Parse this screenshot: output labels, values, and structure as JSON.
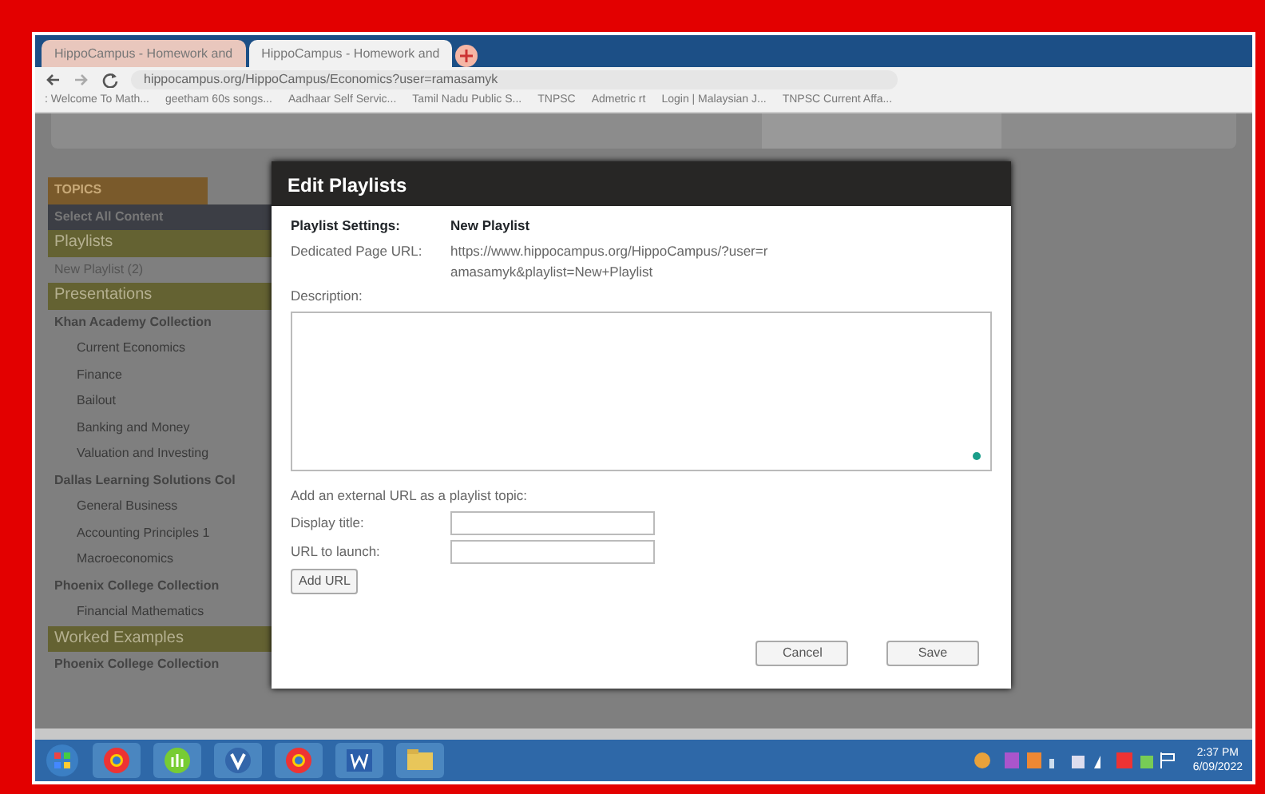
{
  "browser": {
    "tabs": [
      {
        "title": "HippoCampus - Homework and",
        "selected": false
      },
      {
        "title": "HippoCampus - Homework and",
        "selected": true
      }
    ],
    "address": "hippocampus.org/HippoCampus/Economics?user=ramasamyk",
    "bookmarks": [
      ": Welcome To Math...",
      "geetham 60s songs...",
      "Aadhaar Self Servic...",
      "Tamil Nadu Public S...",
      "TNPSC",
      "Admetric rt",
      "Login | Malaysian J...",
      "TNPSC Current Affa..."
    ]
  },
  "sidebar": {
    "items": [
      {
        "kind": "topics",
        "label": "TOPICS"
      },
      {
        "kind": "select_all",
        "label": "Select All Content"
      },
      {
        "kind": "header",
        "label": "Playlists"
      },
      {
        "kind": "playlist",
        "label": "New Playlist (2)"
      },
      {
        "kind": "header",
        "label": "Presentations"
      },
      {
        "kind": "group",
        "label": "Khan Academy Collection"
      },
      {
        "kind": "item",
        "label": "Current Economics"
      },
      {
        "kind": "item",
        "label": "Finance"
      },
      {
        "kind": "item",
        "label": "Bailout"
      },
      {
        "kind": "item",
        "label": "Banking and Money"
      },
      {
        "kind": "item",
        "label": "Valuation and Investing"
      },
      {
        "kind": "group",
        "label": "Dallas Learning Solutions Col"
      },
      {
        "kind": "item",
        "label": "General Business"
      },
      {
        "kind": "item",
        "label": "Accounting Principles 1"
      },
      {
        "kind": "item",
        "label": "Macroeconomics"
      },
      {
        "kind": "group",
        "label": "Phoenix College Collection"
      },
      {
        "kind": "item",
        "label": "Financial Mathematics"
      },
      {
        "kind": "header",
        "label": "Worked Examples"
      },
      {
        "kind": "group",
        "label": "Phoenix College Collection"
      }
    ]
  },
  "dialog": {
    "title": "Edit Playlists",
    "settings_label": "Playlist Settings:",
    "settings_value": "New Playlist",
    "url_label": "Dedicated Page URL:",
    "url_value": "https://www.hippocampus.org/HippoCampus/?user=ramasamyk&playlist=New+Playlist",
    "description_label": "Description:",
    "external_heading": "Add an external URL as a playlist topic:",
    "fields": [
      {
        "label": "Display title:"
      },
      {
        "label": "URL to launch:"
      }
    ],
    "add_button": "Add URL",
    "buttons": [
      "Cancel",
      "Save"
    ]
  },
  "taskbar": {
    "time": "2:37 PM",
    "date": "6/09/2022"
  }
}
